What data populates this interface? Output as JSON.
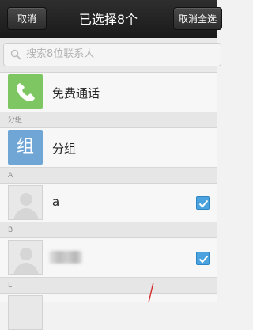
{
  "titlebar": {
    "cancel_label": "取消",
    "title": "已选择8个",
    "deselect_all_label": "取消全选"
  },
  "search": {
    "placeholder": "搜索8位联系人"
  },
  "rows": {
    "free_call_label": "免费通话",
    "group_section_header": "分组",
    "group_tile_glyph": "组",
    "group_label": "分组",
    "section_a": "A",
    "contact_a_name": "a",
    "section_b": "B",
    "section_l": "L"
  },
  "colors": {
    "accent_green": "#7ec661",
    "accent_blue": "#6fa6d6",
    "checkbox_blue": "#4aa3df"
  }
}
